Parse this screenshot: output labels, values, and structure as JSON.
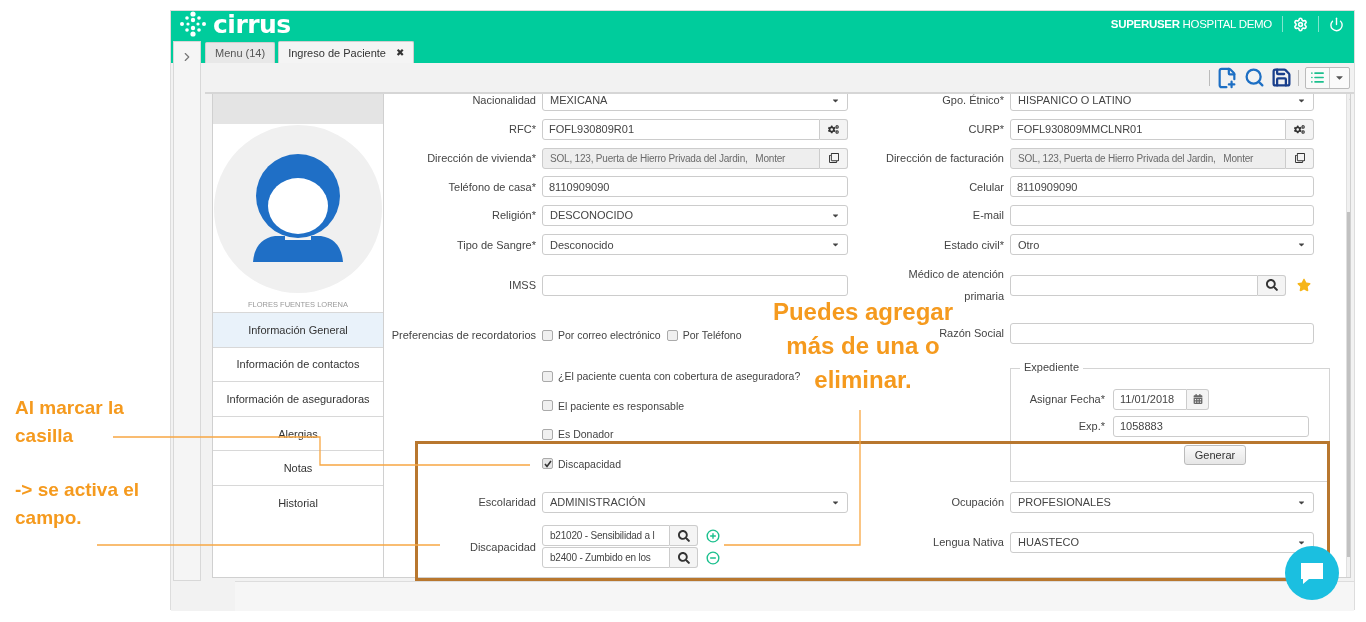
{
  "header": {
    "logo": "cirrus",
    "user": "SUPERUSER",
    "hospital": "HOSPITAL DEMO"
  },
  "tabs": [
    {
      "label": "Menu (14)",
      "selected": false
    },
    {
      "label": "Ingreso de Paciente",
      "selected": true,
      "close": "✖"
    }
  ],
  "patient": {
    "name": "FLORES FUENTES LORENA"
  },
  "sections": [
    {
      "label": "Información General",
      "selected": true
    },
    {
      "label": "Información de contactos",
      "selected": false
    },
    {
      "label": "Información de aseguradoras",
      "selected": false
    },
    {
      "label": "Alergias",
      "selected": false
    },
    {
      "label": "Notas",
      "selected": false
    },
    {
      "label": "Historial",
      "selected": false
    }
  ],
  "left_fields": [
    {
      "kind": "select",
      "label": "Nacionalidad",
      "value": "MEXICANA"
    },
    {
      "kind": "generate",
      "label": "RFC*",
      "value": "FOFL930809R01"
    },
    {
      "kind": "copy",
      "label": "Dirección de vivienda*",
      "value": "SOL, 123, Puerta de Hierro Privada del Jardin,   Monter"
    },
    {
      "kind": "text",
      "label": "Teléfono de casa*",
      "value": "8110909090"
    },
    {
      "kind": "select",
      "label": "Religión*",
      "value": "DESCONOCIDO"
    },
    {
      "kind": "select",
      "label": "Tipo de Sangre*",
      "value": "Desconocido"
    },
    {
      "kind": "text",
      "label": "IMSS"
    },
    {
      "kind": "checks",
      "label": "Preferencias de recordatorios",
      "options": [
        {
          "label": "Por correo electrónico",
          "checked": false
        },
        {
          "label": "Por Teléfono",
          "checked": false
        }
      ]
    },
    {
      "kind": "checkbox",
      "label": "¿El paciente cuenta con cobertura de aseguradora?",
      "checked": false
    },
    {
      "kind": "checkbox",
      "label": "El paciente es responsable",
      "checked": false
    },
    {
      "kind": "checkbox",
      "label": "Es Donador",
      "checked": false
    },
    {
      "kind": "checkbox",
      "label": "Discapacidad",
      "checked": true
    },
    {
      "kind": "select",
      "label": "Escolaridad",
      "value": "ADMINISTRACIÓN"
    },
    {
      "kind": "multi",
      "label": "Discapacidad",
      "items": [
        {
          "value": "b21020 - Sensibilidad a l",
          "kind": "add"
        },
        {
          "value": "b2400 - Zumbido en los",
          "kind": "remove"
        }
      ]
    }
  ],
  "right_fields": [
    {
      "kind": "select",
      "label": "Gpo. Étnico*",
      "value": "HISPANICO O LATINO"
    },
    {
      "kind": "generate",
      "label": "CURP*",
      "value": "FOFL930809MMCLNR01"
    },
    {
      "kind": "copy",
      "label": "Dirección de facturación",
      "value": "SOL, 123, Puerta de Hierro Privada del Jardin,   Monter"
    },
    {
      "kind": "text",
      "label": "Celular",
      "value": "8110909090"
    },
    {
      "kind": "text",
      "label": "E-mail"
    },
    {
      "kind": "select",
      "label": "Estado civil*",
      "value": "Otro"
    },
    {
      "kind": "search",
      "label": "Médico de atención primaria"
    },
    {
      "kind": "text",
      "label": "Razón Social"
    },
    {
      "kind": "fieldset",
      "label": "Expediente",
      "date_label": "Asignar Fecha*",
      "date": "11/01/2018",
      "number_label": "Exp.*",
      "number": "1058883",
      "button": "Generar"
    },
    {
      "kind": "select",
      "label": "Ocupación",
      "value": "PROFESIONALES"
    },
    {
      "kind": "select",
      "label": "Lengua Nativa",
      "value": "HUASTECO"
    }
  ],
  "annotations": {
    "check_note": "Al marcar la casilla",
    "field_note": "-> se activa el campo.",
    "callout": [
      "Puedes agregar",
      "más de una o",
      "eliminar."
    ]
  }
}
